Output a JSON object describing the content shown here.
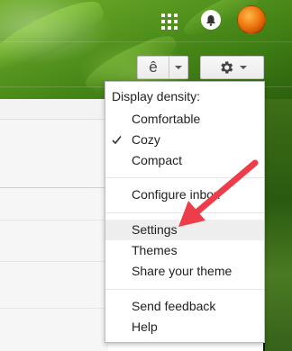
{
  "header": {
    "apps_icon": "apps-grid-icon",
    "notifications_icon": "bell-icon",
    "avatar": "orange-avatar"
  },
  "toolbar": {
    "input_tools_glyph": "ê",
    "input_tools_icon": "chevron-down-icon",
    "settings_icon": "gear-icon"
  },
  "menu": {
    "heading": "Display density:",
    "density_options": [
      {
        "label": "Comfortable",
        "checked": false
      },
      {
        "label": "Cozy",
        "checked": true
      },
      {
        "label": "Compact",
        "checked": false
      }
    ],
    "configure_inbox": "Configure inbox",
    "settings": "Settings",
    "themes": "Themes",
    "share_theme": "Share your theme",
    "send_feedback": "Send feedback",
    "help": "Help"
  },
  "annotation": {
    "arrow_color": "#ee3d4a",
    "points_to": "Settings"
  },
  "colors": {
    "background_green": "#2f6a12",
    "menu_hover": "#eeeeee",
    "button_border": "#c6c6c6"
  }
}
